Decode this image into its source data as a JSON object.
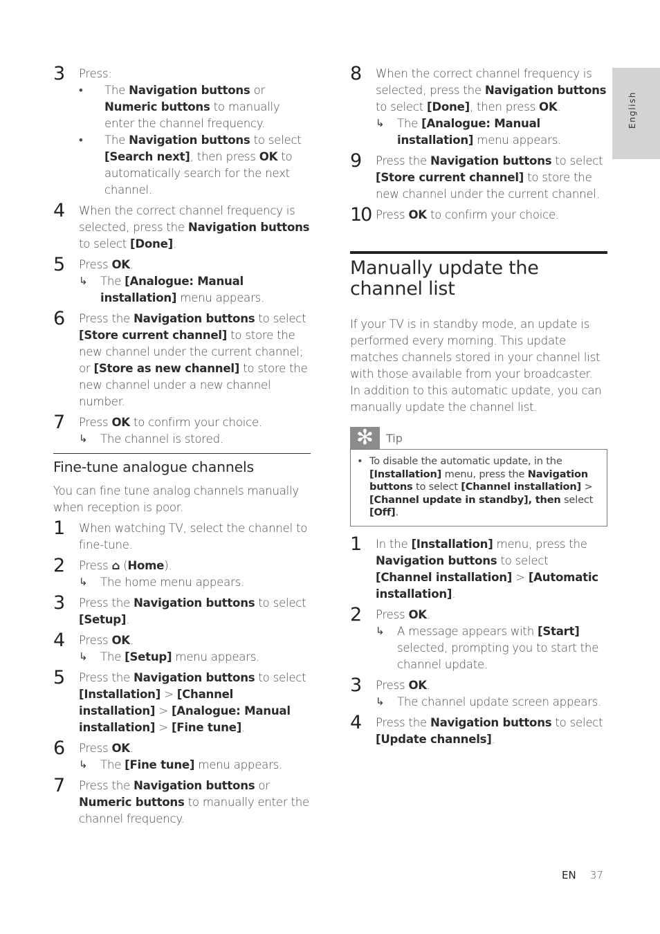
{
  "side_tab": {
    "label": "English"
  },
  "footer": {
    "lang": "EN",
    "page": "37"
  },
  "left_column": {
    "steps_top": [
      {
        "num": "3",
        "lines": [
          [
            {
              "t": "Press:"
            }
          ]
        ],
        "bullets": [
          [
            {
              "t": "The "
            },
            {
              "t": "Navigation buttons",
              "b": true
            },
            {
              "t": " or "
            },
            {
              "t": "Numeric buttons",
              "b": true
            },
            {
              "t": " to manually enter the channel frequency."
            }
          ],
          [
            {
              "t": "The "
            },
            {
              "t": "Navigation buttons",
              "b": true
            },
            {
              "t": " to select "
            },
            {
              "t": "[Search next]",
              "b": true
            },
            {
              "t": ", then press "
            },
            {
              "t": "OK",
              "b": true
            },
            {
              "t": " to automatically search for the next channel."
            }
          ]
        ]
      },
      {
        "num": "4",
        "lines": [
          [
            {
              "t": "When the correct channel frequency is selected, press the "
            },
            {
              "t": "Navigation buttons",
              "b": true
            },
            {
              "t": " to select "
            },
            {
              "t": "[Done]",
              "b": true
            },
            {
              "t": "."
            }
          ]
        ]
      },
      {
        "num": "5",
        "lines": [
          [
            {
              "t": "Press "
            },
            {
              "t": "OK",
              "b": true
            },
            {
              "t": "."
            }
          ]
        ],
        "result": [
          {
            "t": "The "
          },
          {
            "t": "[Analogue: Manual installation]",
            "b": true
          },
          {
            "t": " menu appears."
          }
        ]
      },
      {
        "num": "6",
        "lines": [
          [
            {
              "t": "Press the "
            },
            {
              "t": "Navigation buttons",
              "b": true
            },
            {
              "t": " to select "
            },
            {
              "t": "[Store current channel]",
              "b": true
            },
            {
              "t": " to store the new channel under the current channel; or "
            },
            {
              "t": "[Store as new channel]",
              "b": true
            },
            {
              "t": " to store the new channel under a new channel number."
            }
          ]
        ]
      },
      {
        "num": "7",
        "lines": [
          [
            {
              "t": "Press "
            },
            {
              "t": "OK",
              "b": true
            },
            {
              "t": " to confirm your choice."
            }
          ]
        ],
        "result": [
          {
            "t": "The channel is stored."
          }
        ]
      }
    ],
    "section_title": "Fine-tune analogue channels",
    "section_intro": "You can fine tune analog channels manually when reception is poor.",
    "steps_bottom": [
      {
        "num": "1",
        "lines": [
          [
            {
              "t": "When watching TV, select the channel to fine-tune."
            }
          ]
        ]
      },
      {
        "num": "2",
        "lines": [
          [
            {
              "t": "Press "
            },
            {
              "icon": "home"
            },
            {
              "t": " ("
            },
            {
              "t": "Home",
              "b": true
            },
            {
              "t": ")."
            }
          ]
        ],
        "result": [
          {
            "t": "The home menu appears."
          }
        ]
      },
      {
        "num": "3",
        "lines": [
          [
            {
              "t": "Press the "
            },
            {
              "t": "Navigation buttons",
              "b": true
            },
            {
              "t": " to select "
            },
            {
              "t": "[Setup]",
              "b": true
            },
            {
              "t": "."
            }
          ]
        ]
      },
      {
        "num": "4",
        "lines": [
          [
            {
              "t": "Press "
            },
            {
              "t": "OK",
              "b": true
            },
            {
              "t": "."
            }
          ]
        ],
        "result": [
          {
            "t": "The "
          },
          {
            "t": "[Setup]",
            "b": true
          },
          {
            "t": " menu appears."
          }
        ]
      },
      {
        "num": "5",
        "lines": [
          [
            {
              "t": "Press the "
            },
            {
              "t": "Navigation buttons",
              "b": true
            },
            {
              "t": " to select "
            },
            {
              "t": "[Installation]",
              "b": true
            },
            {
              "t": " > "
            },
            {
              "t": "[Channel installation]",
              "b": true
            },
            {
              "t": " > "
            },
            {
              "t": "[Analogue: Manual installation]",
              "b": true
            },
            {
              "t": " > "
            },
            {
              "t": "[Fine tune]",
              "b": true
            },
            {
              "t": "."
            }
          ]
        ]
      },
      {
        "num": "6",
        "lines": [
          [
            {
              "t": "Press "
            },
            {
              "t": "OK",
              "b": true
            },
            {
              "t": "."
            }
          ]
        ],
        "result": [
          {
            "t": "The "
          },
          {
            "t": "[Fine tune]",
            "b": true
          },
          {
            "t": " menu appears."
          }
        ]
      },
      {
        "num": "7",
        "lines": [
          [
            {
              "t": "Press the "
            },
            {
              "t": "Navigation buttons",
              "b": true
            },
            {
              "t": " or "
            },
            {
              "t": "Numeric buttons",
              "b": true
            },
            {
              "t": " to manually enter the channel frequency."
            }
          ]
        ]
      }
    ]
  },
  "right_column": {
    "steps_top": [
      {
        "num": "8",
        "lines": [
          [
            {
              "t": "When the correct channel frequency is selected, press the "
            },
            {
              "t": "Navigation buttons",
              "b": true
            },
            {
              "t": " to select "
            },
            {
              "t": "[Done]",
              "b": true
            },
            {
              "t": ", then press "
            },
            {
              "t": "OK",
              "b": true
            },
            {
              "t": "."
            }
          ]
        ],
        "result": [
          {
            "t": "The "
          },
          {
            "t": "[Analogue: Manual installation]",
            "b": true
          },
          {
            "t": " menu appears."
          }
        ]
      },
      {
        "num": "9",
        "lines": [
          [
            {
              "t": "Press the "
            },
            {
              "t": "Navigation buttons",
              "b": true
            },
            {
              "t": " to select "
            },
            {
              "t": "[Store current channel]",
              "b": true
            },
            {
              "t": " to store the new channel under the current channel."
            }
          ]
        ]
      },
      {
        "num": "10",
        "lines": [
          [
            {
              "t": "Press "
            },
            {
              "t": "OK",
              "b": true
            },
            {
              "t": " to confirm your choice."
            }
          ]
        ]
      }
    ],
    "section_title": "Manually update the channel list",
    "section_intro_1": "If your TV is in standby mode, an update is performed every morning. This update matches channels stored in your channel list with those available from your broadcaster.",
    "section_intro_2": "In addition to this automatic update, you can manually update the channel list.",
    "tip": {
      "label": "Tip",
      "icon": "asterisk-icon",
      "text": [
        {
          "t": "To disable the automatic update, in the "
        },
        {
          "t": "[Installation]",
          "b": true
        },
        {
          "t": " menu, press the "
        },
        {
          "t": "Navigation buttons",
          "b": true
        },
        {
          "t": " to select "
        },
        {
          "t": "[Channel installation]",
          "b": true
        },
        {
          "t": " > "
        },
        {
          "t": "[Channel update in standby], then",
          "b": true
        },
        {
          "t": " select "
        },
        {
          "t": "[Off]",
          "b": true
        },
        {
          "t": "."
        }
      ]
    },
    "steps_bottom": [
      {
        "num": "1",
        "lines": [
          [
            {
              "t": "In the "
            },
            {
              "t": "[Installation]",
              "b": true
            },
            {
              "t": " menu, press the "
            },
            {
              "t": "Navigation buttons",
              "b": true
            },
            {
              "t": " to select "
            },
            {
              "t": "[Channel installation]",
              "b": true
            },
            {
              "t": " > "
            },
            {
              "t": "[Automatic installation]",
              "b": true
            },
            {
              "t": "."
            }
          ]
        ]
      },
      {
        "num": "2",
        "lines": [
          [
            {
              "t": "Press "
            },
            {
              "t": "OK",
              "b": true
            },
            {
              "t": "."
            }
          ]
        ],
        "result": [
          {
            "t": "A message appears with "
          },
          {
            "t": "[Start]",
            "b": true
          },
          {
            "t": " selected, prompting you to start the channel update."
          }
        ]
      },
      {
        "num": "3",
        "lines": [
          [
            {
              "t": "Press "
            },
            {
              "t": "OK",
              "b": true
            },
            {
              "t": "."
            }
          ]
        ],
        "result": [
          {
            "t": "The channel update screen appears."
          }
        ]
      },
      {
        "num": "4",
        "lines": [
          [
            {
              "t": "Press the "
            },
            {
              "t": "Navigation buttons",
              "b": true
            },
            {
              "t": " to select "
            },
            {
              "t": "[Update channels]",
              "b": true
            },
            {
              "t": "."
            }
          ]
        ]
      }
    ]
  },
  "glyphs": {
    "bullet": "•",
    "result_arrow": "↳",
    "home": "⌂",
    "tip": "✻"
  }
}
